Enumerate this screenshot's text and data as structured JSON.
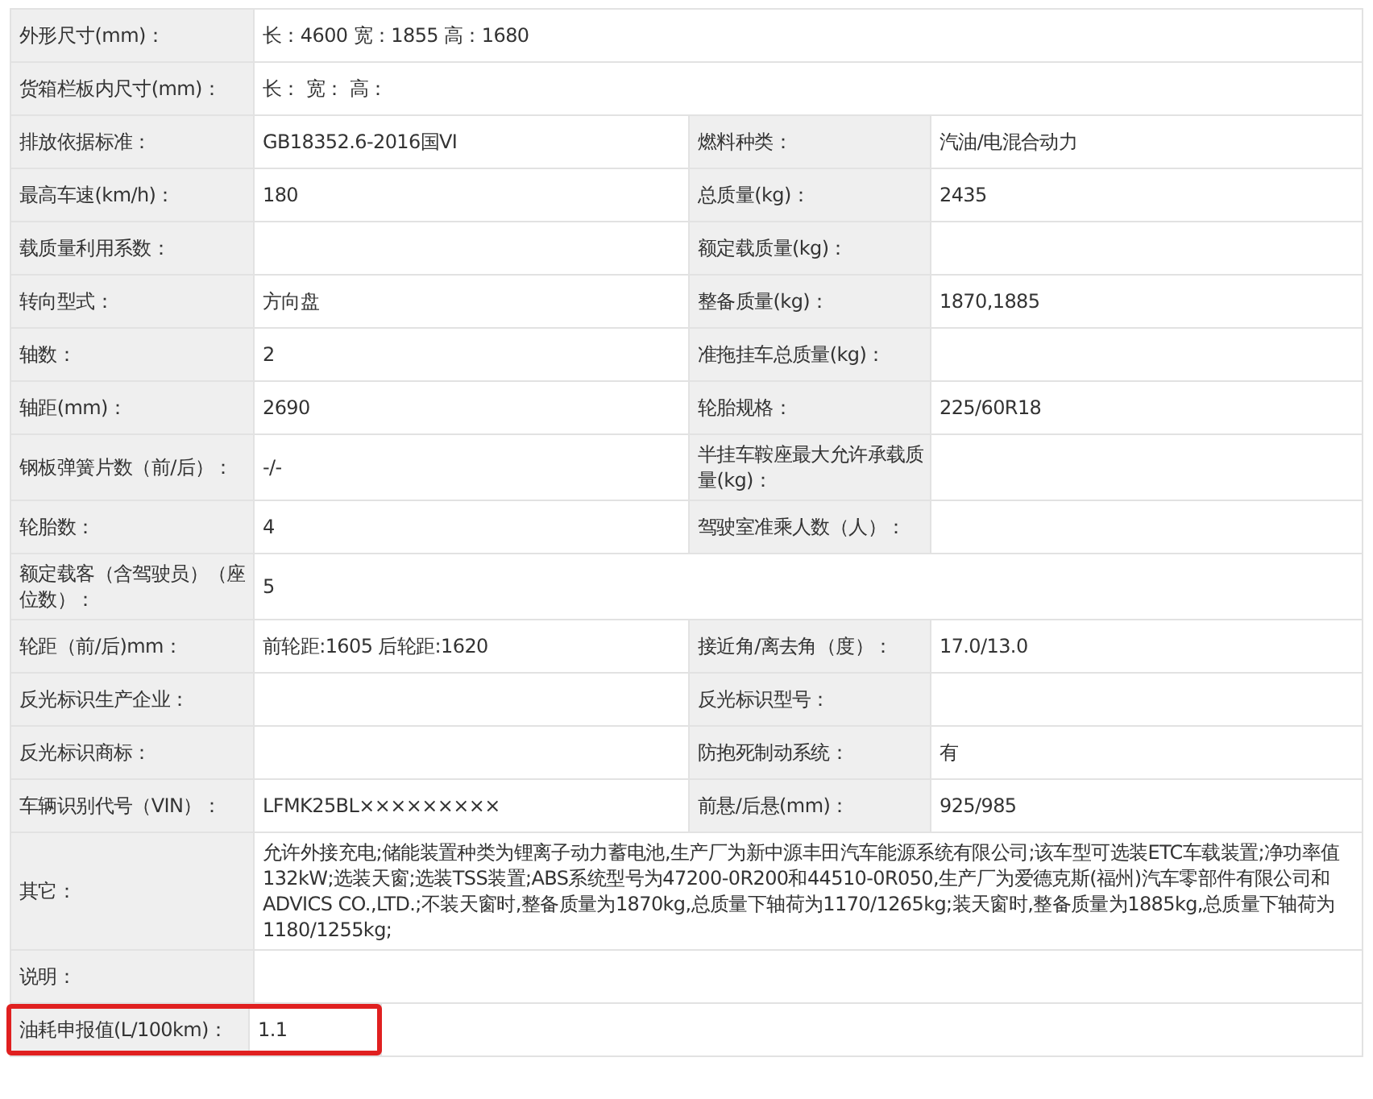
{
  "rows": [
    {
      "label": "外形尺寸(mm)：",
      "value": "长：4600 宽：1855 高：1680",
      "highlighted": false
    },
    {
      "label": "货箱栏板内尺寸(mm)：",
      "value": "长： 宽： 高：",
      "highlighted": false
    },
    {
      "label": "排放依据标准：",
      "value": "GB18352.6-2016国VI",
      "label_2": "燃料种类：",
      "value_2": "汽油/电混合动力",
      "highlighted": false
    },
    {
      "label": "最高车速(km/h)：",
      "value": "180",
      "label_2": "总质量(kg)：",
      "value_2": "2435",
      "highlighted": false
    },
    {
      "label": "载质量利用系数：",
      "label_2": "额定载质量(kg)：",
      "highlighted": false
    },
    {
      "label": "转向型式：",
      "value": "方向盘",
      "label_2": "整备质量(kg)：",
      "value_2": "1870,1885",
      "highlighted": false
    },
    {
      "label": "轴数：",
      "value": "2",
      "label_2": "准拖挂车总质量(kg)：",
      "highlighted": false
    },
    {
      "label": "轴距(mm)：",
      "value": "2690",
      "label_2": "轮胎规格：",
      "value_2": "225/60R18",
      "highlighted": false
    },
    {
      "label": "钢板弹簧片数（前/后）：",
      "value": "-/-",
      "label_2": "半挂车鞍座最大允许承载质量(kg)：",
      "highlighted": false
    },
    {
      "label": "轮胎数：",
      "value": "4",
      "label_2": "驾驶室准乘人数（人）：",
      "highlighted": false
    },
    {
      "label": "额定载客（含驾驶员）（座位数）：",
      "value": "5",
      "highlighted": false
    },
    {
      "label": "轮距（前/后)mm：",
      "value": "前轮距:1605 后轮距:1620",
      "label_2": "接近角/离去角（度）：",
      "value_2": "17.0/13.0",
      "highlighted": false
    },
    {
      "label": "反光标识生产企业：",
      "label_2": "反光标识型号：",
      "highlighted": false
    },
    {
      "label": "反光标识商标：",
      "label_2": "防抱死制动系统：",
      "value_2": "有",
      "highlighted": false
    },
    {
      "label": "车辆识别代号（VIN）：",
      "value": "LFMK25BL×××××××××",
      "label_2": "前悬/后悬(mm)：",
      "value_2": "925/985",
      "highlighted": false
    },
    {
      "label": "其它：",
      "value": "允许外接充电;储能装置种类为锂离子动力蓄电池,生产厂为新中源丰田汽车能源系统有限公司;该车型可选装ETC车载装置;净功率值132kW;选装天窗;选装TSS装置;ABS系统型号为47200-0R200和44510-0R050,生产厂为爱德克斯(福州)汽车零部件有限公司和ADVICS CO.,LTD.;不装天窗时,整备质量为1870kg,总质量下轴荷为1170/1265kg;装天窗时,整备质量为1885kg,总质量下轴荷为1180/1255kg;",
      "highlighted": false
    },
    {
      "label": "说明：",
      "highlighted": false
    },
    {
      "label": "油耗申报值(L/100km)：",
      "value": "1.1",
      "highlighted": true
    }
  ]
}
